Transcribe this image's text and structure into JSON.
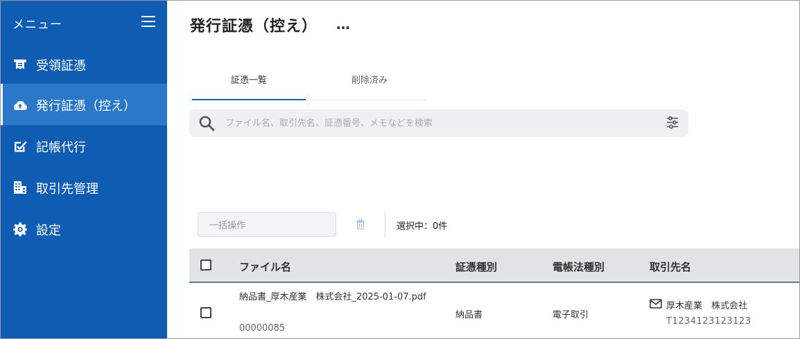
{
  "sidebar": {
    "title": "メニュー",
    "items": [
      {
        "label": "受領証憑",
        "icon": "receipt-icon",
        "active": false
      },
      {
        "label": "発行証憑（控え）",
        "icon": "upload-cloud-icon",
        "active": true
      },
      {
        "label": "記帳代行",
        "icon": "edit-check-icon",
        "active": false
      },
      {
        "label": "取引先管理",
        "icon": "building-icon",
        "active": false
      },
      {
        "label": "設定",
        "icon": "gear-icon",
        "active": false
      }
    ]
  },
  "header": {
    "title": "発行証憑（控え）",
    "more": "…"
  },
  "tabs": [
    {
      "label": "証憑一覧",
      "active": true
    },
    {
      "label": "削除済み",
      "active": false
    }
  ],
  "search": {
    "placeholder": "ファイル名、取引先名、証憑番号、メモなどを検索",
    "value": ""
  },
  "toolbar": {
    "bulk_label": "一括操作",
    "selection": "選択中：0件"
  },
  "table": {
    "headers": [
      "ファイル名",
      "証憑種別",
      "電帳法種別",
      "取引先名"
    ],
    "rows": [
      {
        "filename": "納品書_厚木産業　株式会社_2025-01-07.pdf",
        "id": "00000085",
        "doc_type": "納品書",
        "law_type": "電子取引",
        "partner": "厚木産業　株式会社",
        "partner_code": "T1234123123123"
      }
    ]
  },
  "colors": {
    "sidebar_bg": "#0f5db3",
    "sidebar_active": "#2b78c9",
    "tab_accent": "#1565c0",
    "table_header_bg": "#e1e3e5"
  }
}
